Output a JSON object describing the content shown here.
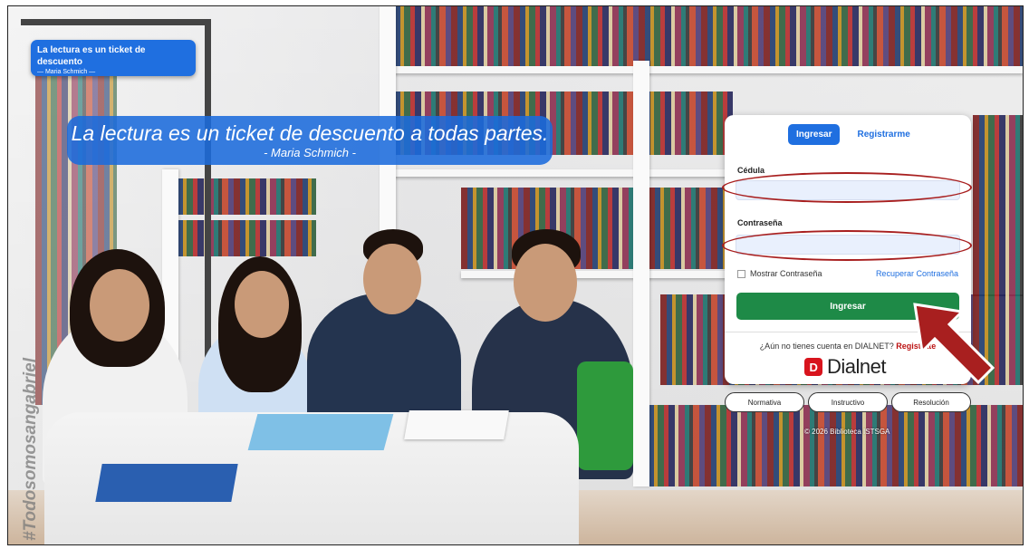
{
  "quote_badge": {
    "title": "La lectura es un ticket de descuento",
    "author": "— Maria Schmich —"
  },
  "big_quote": {
    "text": "La lectura es un ticket de descuento a todas partes.",
    "author": "- Maria Schmich -"
  },
  "watermark": "#Todosomosangabriel",
  "login": {
    "tab_login": "Ingresar",
    "tab_register": "Registrarme",
    "cedula_label": "Cédula",
    "cedula_value": "",
    "password_label": "Contraseña",
    "password_value": "",
    "show_password": "Mostrar Contraseña",
    "recover_password": "Recuperar Contraseña",
    "submit_label": "Ingresar",
    "no_account_text": "¿Aún no tienes cuenta en DIALNET?",
    "register_link": "Registrate",
    "dialnet_logo_text": "Dialnet",
    "dialnet_icon": "D"
  },
  "footer_buttons": {
    "normativa": "Normativa",
    "instructivo": "Instructivo",
    "resolucion": "Resolución"
  },
  "copyright": "© 2026 Biblioteca ISTSGA",
  "colors": {
    "primary": "#1f6fe0",
    "submit_green": "#1e8a47",
    "annotation_red": "#a81f1f",
    "dialnet_red": "#d8141d"
  }
}
